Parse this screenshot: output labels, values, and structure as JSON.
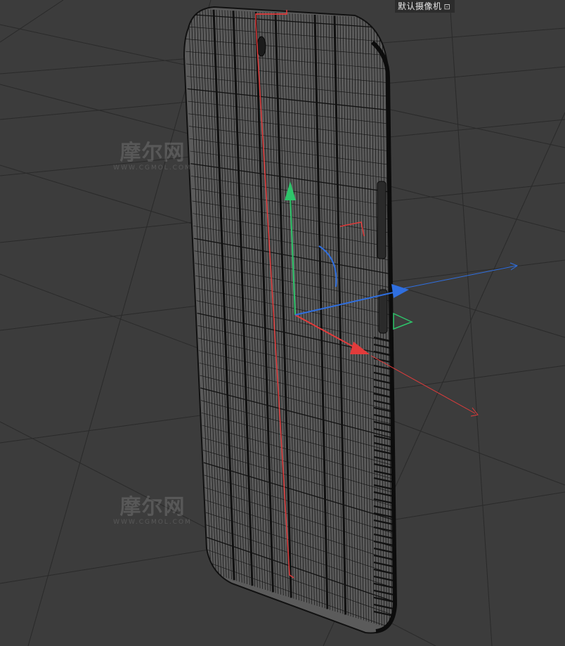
{
  "viewport": {
    "camera_label": "默认摄像机",
    "camera_icon": "camera-link-icon",
    "background_color": "#3c3c3c",
    "grid_color": "#2a2a2a"
  },
  "model": {
    "name": "phone-wireframe",
    "wire_color": "#111111",
    "body_color": "#5a5a5a"
  },
  "gizmo": {
    "x_axis_color": "#e23b3b",
    "y_axis_color": "#2ec46a",
    "z_axis_color": "#2f6fe0"
  },
  "watermarks": [
    {
      "main": "摩尔网",
      "sub": "WWW.CGMOL.COM"
    },
    {
      "main": "摩尔网",
      "sub": "WWW.CGMOL.COM"
    }
  ]
}
